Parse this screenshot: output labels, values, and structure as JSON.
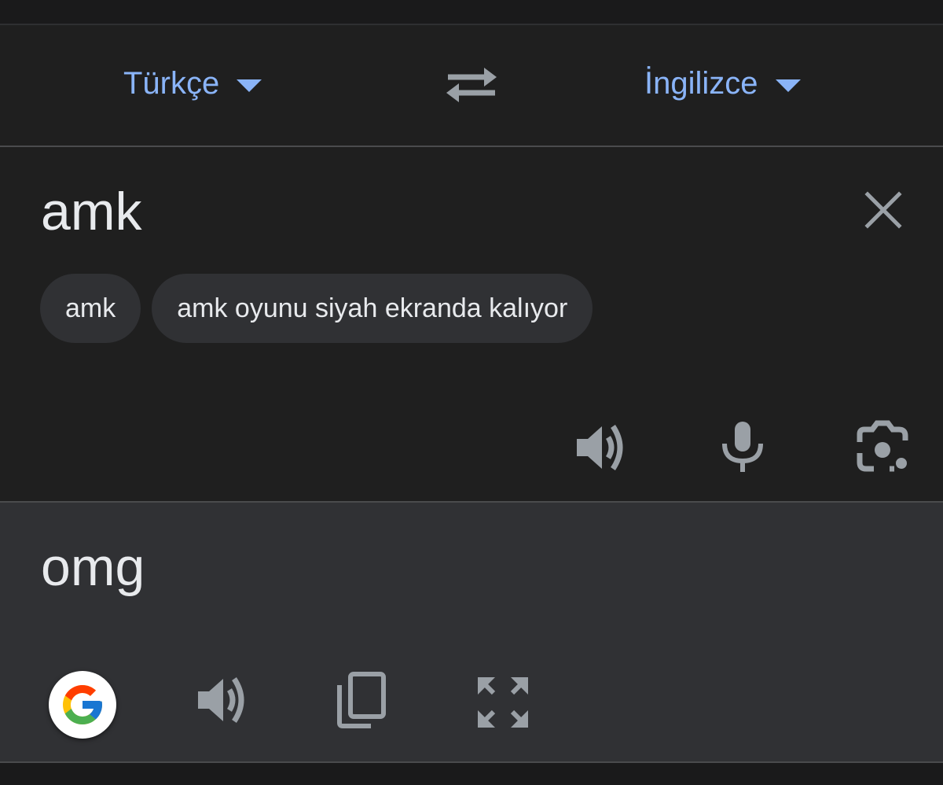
{
  "language_bar": {
    "source_language": "Türkçe",
    "target_language": "İngilizce",
    "swap_icon": "swap-arrows-icon",
    "dropdown_icon": "caret-down-icon",
    "accent_color": "#8ab4f8"
  },
  "input": {
    "source_text": "amk",
    "clear_icon": "close-icon",
    "suggestions": [
      {
        "label": "amk"
      },
      {
        "label": "amk oyunu siyah ekranda kalıyor"
      }
    ],
    "actions": [
      "speaker-icon",
      "microphone-icon",
      "camera-lens-icon"
    ]
  },
  "output": {
    "translated_text": "omg",
    "actions": [
      "google-logo-icon",
      "speaker-icon",
      "copy-icon",
      "fullscreen-icon"
    ]
  },
  "colors": {
    "background": "#1f1f1f",
    "output_background": "#303134",
    "chip_background": "#303134",
    "text": "#e8eaed",
    "icon": "#9aa0a6"
  }
}
